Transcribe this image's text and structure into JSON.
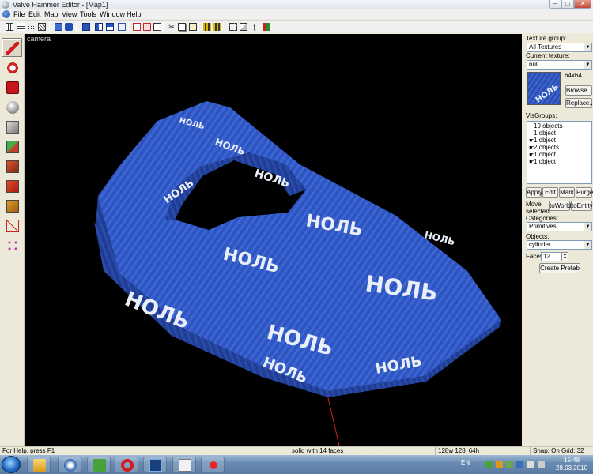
{
  "window": {
    "title": "Valve Hammer Editor - [Map1]",
    "min": "–",
    "max": "□",
    "close": "✕"
  },
  "menu": [
    "File",
    "Edit",
    "Map",
    "View",
    "Tools",
    "Window",
    "Help"
  ],
  "toolbar": {
    "icons": [
      "grid-icon",
      "grid-toggle-icon",
      "grid-dots-icon",
      "grid-3d-icon",
      "load-window-state-icon",
      "undo-icon",
      "group-icon",
      "ungroup-icon",
      "toggle-group-ignore-icon",
      "hide-items-icon",
      "show-items-icon",
      "texture-lock-icon",
      "cut-icon",
      "copy-icon",
      "paste-icon",
      "carve-icon",
      "hollow-icon",
      "texture-application-icon",
      "run-map-icon",
      "entity-report-icon",
      "check-problems-icon"
    ]
  },
  "tools": [
    "selection-tool-icon",
    "magnify-tool-icon",
    "camera-tool-icon",
    "entity-tool-icon",
    "block-tool-icon",
    "texture-application-tool-icon",
    "apply-texture-tool-icon",
    "decal-tool-icon",
    "overlay-tool-icon",
    "clipping-tool-icon",
    "vertex-tool-icon"
  ],
  "viewport": {
    "label": "camera",
    "brush_text": "НОЛЬ",
    "colors": {
      "brush_top": "#3a5fc8",
      "brush_side": "#203d8e",
      "brush_dark": "#142a66",
      "axis": "#d21f1f"
    }
  },
  "panel": {
    "texture_group_label": "Texture group:",
    "texture_group_value": "All Textures",
    "current_texture_label": "Current texture:",
    "current_texture_value": "null",
    "texture_size": "64x64",
    "texture_preview_text": "НОЛЬ",
    "browse_button": "Browse...",
    "replace_button": "Replace...",
    "visgroups_label": "VisGroups:",
    "visgroups": [
      {
        "label": "19 objects",
        "checked": false
      },
      {
        "label": "1 object",
        "checked": false
      },
      {
        "label": "1 object",
        "checked": true
      },
      {
        "label": "2 objects",
        "checked": true
      },
      {
        "label": "1 object",
        "checked": true
      },
      {
        "label": "1 object",
        "checked": true
      }
    ],
    "apply_button": "Apply",
    "edit_button": "Edit",
    "mark_button": "Mark",
    "purge_button": "Purge",
    "move_selected_label_1": "Move",
    "move_selected_label_2": "selected",
    "to_world_button": "toWorld",
    "to_entity_button": "toEntity",
    "categories_label": "Categories:",
    "categories_value": "Primitives",
    "objects_label": "Objects:",
    "objects_value": "cylinder",
    "faces_label": "Faces:",
    "faces_value": "12",
    "create_prefab_button": "Create Prefab"
  },
  "status": {
    "help": "For Help, press F1",
    "selection": "solid with 14 faces",
    "size": "128w 128l 64h",
    "snap": "Snap: On Grid: 32"
  },
  "taskbar": {
    "apps": [
      "windows-explorer-icon",
      "hammer-editor-icon",
      "utorrent-icon",
      "opera-icon",
      "photoshop-icon",
      "mail-icon",
      "game-icon"
    ],
    "language": "EN",
    "time": "15:48",
    "date": "28.03.2010"
  }
}
